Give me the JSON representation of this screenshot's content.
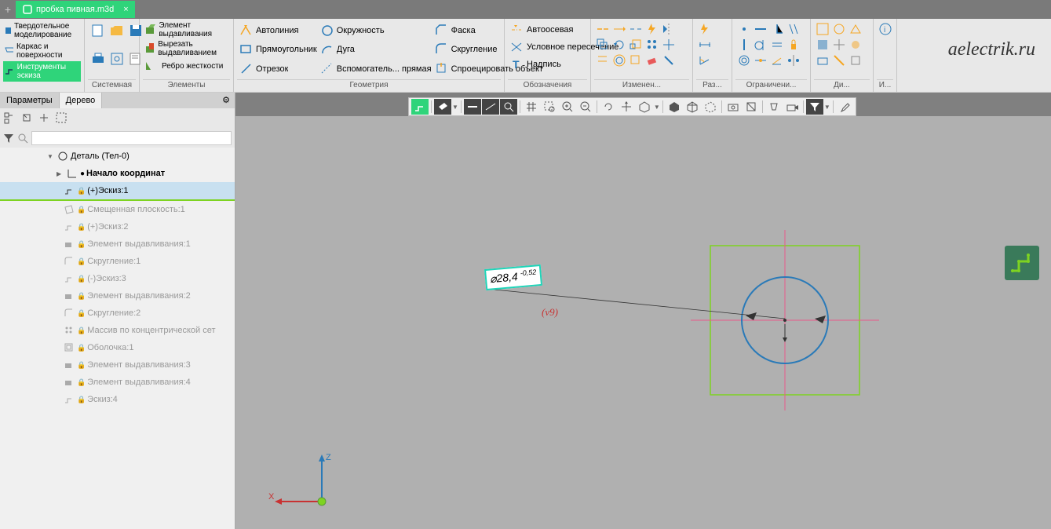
{
  "tab": {
    "title": "пробка пивная.m3d",
    "close": "×"
  },
  "modes": {
    "solid": "Твердотельное моделирование",
    "wireframe": "Каркас и поверхности",
    "sketch": "Инструменты эскиза"
  },
  "groups": {
    "system": "Системная",
    "elements": "Элементы",
    "geometry": "Геометрия",
    "designation": "Обозначения",
    "modification": "Изменен...",
    "dim": "Раз...",
    "constraints": "Ограничени...",
    "diag": "Ди...",
    "i": "И..."
  },
  "elements": {
    "extrude": "Элемент выдавливания",
    "cut": "Вырезать выдавливанием",
    "rib": "Ребро жесткости"
  },
  "geometry": {
    "autoline": "Автолиния",
    "rect": "Прямоугольник",
    "segment": "Отрезок",
    "circle": "Окружность",
    "arc": "Дуга",
    "aux": "Вспомогатель... прямая",
    "chamfer": "Фаска",
    "fillet": "Скругление",
    "project": "Спроецировать объект"
  },
  "designation": {
    "autoaxis": "Автоосевая",
    "condint": "Условное пересечение",
    "text": "Надпись"
  },
  "panel": {
    "params": "Параметры",
    "tree": "Дерево"
  },
  "tree": {
    "root": "Деталь (Тел-0)",
    "origin": "Начало координат",
    "items": [
      "(+)Эскиз:1",
      "Смещенная плоскость:1",
      "(+)Эскиз:2",
      "Элемент выдавливания:1",
      "Скругление:1",
      "(-)Эскиз:3",
      "Элемент выдавливания:2",
      "Скругление:2",
      "Массив по концентрической сет",
      "Оболочка:1",
      "Элемент выдавливания:3",
      "Элемент выдавливания:4",
      "Эскиз:4"
    ]
  },
  "dimension": {
    "value": "⌀28,4",
    "tol": "-0,52",
    "label": "(v9)"
  },
  "watermark": "aelectrik.ru"
}
